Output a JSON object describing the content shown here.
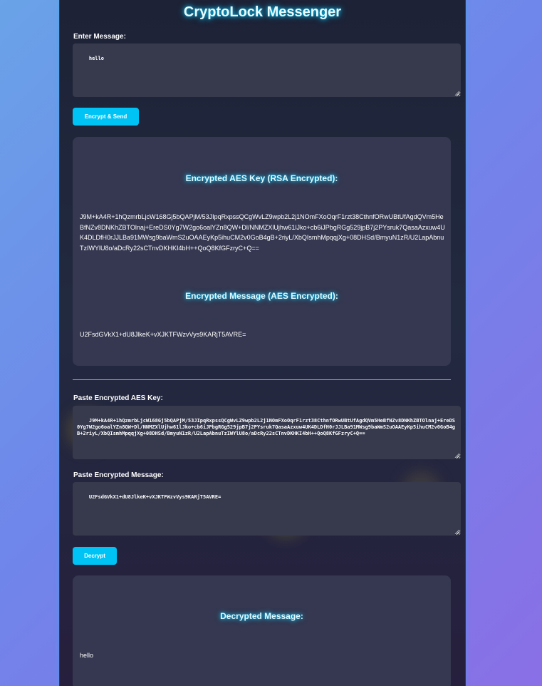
{
  "app": {
    "title": "CryptoLock Messenger"
  },
  "encrypt": {
    "label": "Enter Message:",
    "message_value": "hello",
    "button_label": "Encrypt & Send"
  },
  "encrypted_panel": {
    "aes_key_title": "Encrypted AES Key (RSA Encrypted):",
    "aes_key_value": "J9M+kA4R+1hQzmrbLjcW168Gj5bQAPjM/53JIpqRxpssQCgWvLZ9wpb2L2j1NOmFXoOqrF1rzt38CthnfORwUBtUfAgdQVm5HeBfNZv8DNKhZBTOlnaj+EreDS0Yg7W2go6oalYZn8QW+Dl/NNMZXlUjhw61lJko+cb6iJPbgRGg529jpB7j2PYsruk7QasaAzxuw4UK4DLDfH0rJJLBa91MWsg9baWmS2uOAAEyKp5ihuCM2v0GoB4gB+2riyL/XbQIsmhMpqqjXg+08DHSd/BmyuN1zR/U2LapAbnuTzIWYlU8o/aDcRy22sCTnvDKHKI4bH++QoQ8KfGFzryC+Q==",
    "message_title": "Encrypted Message (AES Encrypted):",
    "message_value": "U2FsdGVkX1+dU8JlkeK+vXJKTFWzvVys9KARjT5AVRE="
  },
  "decrypt": {
    "aes_key_label": "Paste Encrypted AES Key:",
    "aes_key_value": "J9M+kA4R+1hQzmrbLjcW168Gj5bQAPjM/53JIpqRxpssQCgWvLZ9wpb2L2j1NOmFXoOqrF1rzt38CthnfORwUBtUfAgdQVm5HeBfNZv8DNKhZBTOlnaj+EreDS0Yg7W2go6oalYZn8QW+Dl/NNMZXlUjhw61lJko+cb6iJPbgRGg529jpB7j2PYsruk7QasaAzxuw4UK4DLDfH0rJJLBa91MWsg9baWmS2uOAAEyKp5ihuCM2v0GoB4gB+2riyL/XbQIsmhMpqqjXg+08DHSd/BmyuN1zR/U2LapAbnuTzIWYlU8o/aDcRy22sCTnvDKHKI4bH++QoQ8KfGFzryC+Q==",
    "message_label": "Paste Encrypted Message:",
    "message_value": "U2FsdGVkX1+dU8JlkeK+vXJKTFWzvVys9KARjT5AVRE=",
    "button_label": "Decrypt"
  },
  "decrypted_panel": {
    "title": "Decrypted Message:",
    "value": "hello"
  },
  "colors": {
    "accent": "#00c3f5",
    "glow": "#00c8ff",
    "panel_bg": "#353850",
    "container_bg": "#1d2236"
  }
}
